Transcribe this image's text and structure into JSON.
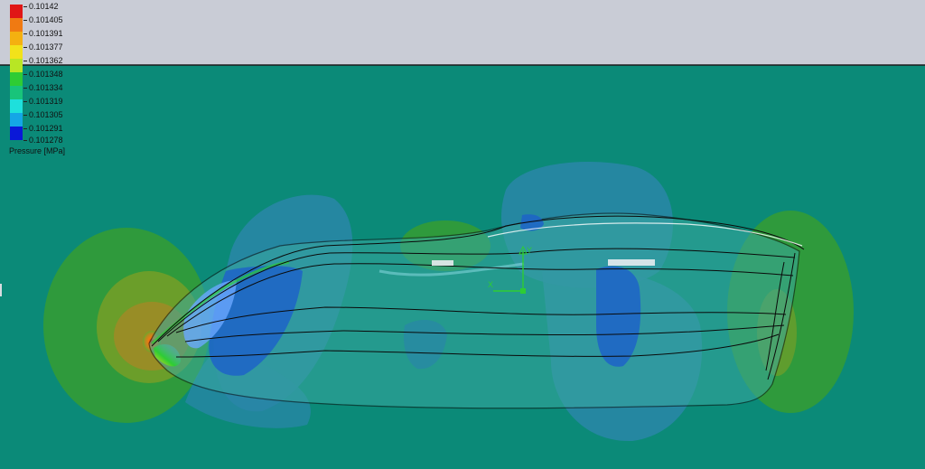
{
  "legend": {
    "title": "Pressure [MPa]",
    "labels": [
      "0.10142",
      "0.101405",
      "0.101391",
      "0.101377",
      "0.101362",
      "0.101348",
      "0.101334",
      "0.101319",
      "0.101305",
      "0.101291",
      "0.101278"
    ],
    "colors": [
      "#e01616",
      "#f07a12",
      "#f4b010",
      "#f2e21a",
      "#b8e624",
      "#2ecc34",
      "#18c47a",
      "#1ee0dc",
      "#14a6e6",
      "#1465e6",
      "#0a18d8"
    ]
  },
  "colors": {
    "sky": "#c9ccd6",
    "ground": "#0b8a78",
    "body_glass": "#3aa8a0"
  },
  "triad": {
    "y_label": "Y",
    "x_label": "X"
  }
}
